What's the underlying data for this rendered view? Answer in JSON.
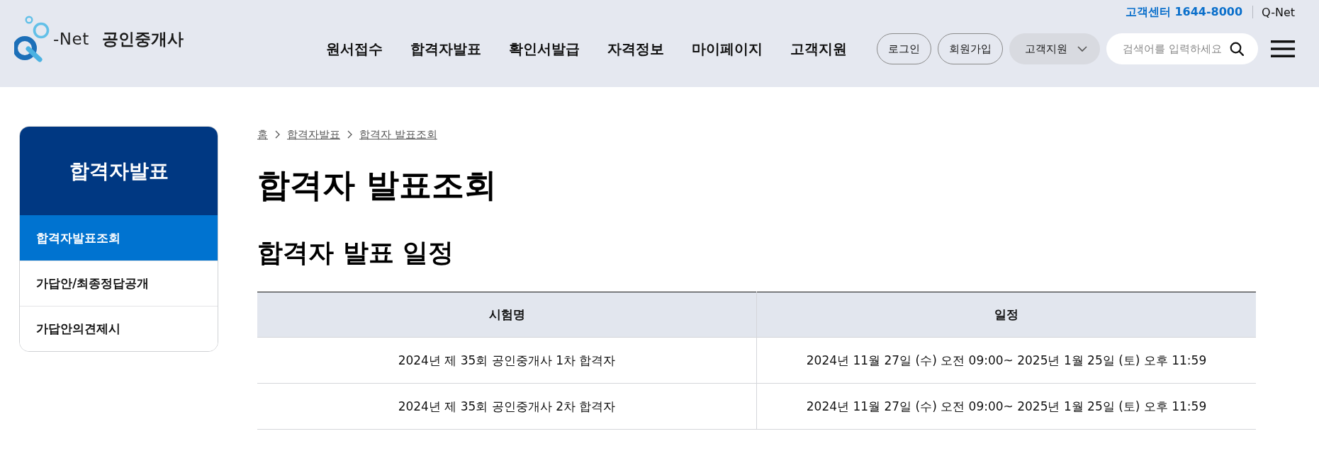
{
  "header": {
    "utility": {
      "phone": "고객센터 1644-8000",
      "link": "Q-Net"
    },
    "logo": {
      "wordmark": "-Net",
      "title": "공인중개사"
    },
    "nav": [
      "원서접수",
      "합격자발표",
      "확인서발급",
      "자격정보",
      "마이페이지",
      "고객지원"
    ],
    "buttons": [
      {
        "label": "로그인",
        "kind": "outline"
      },
      {
        "label": "회원가입",
        "kind": "outline"
      },
      {
        "label": "고객지원",
        "kind": "dropdown"
      }
    ],
    "search": {
      "placeholder": "검색어를 입력하세요"
    }
  },
  "sidebar": {
    "title": "합격자발표",
    "items": [
      {
        "label": "합격자발표조회",
        "selected": true
      },
      {
        "label": "가답안/최종정답공개",
        "selected": false
      },
      {
        "label": "가답안의견제시",
        "selected": false
      }
    ]
  },
  "breadcrumb": [
    "홈",
    "합격자발표",
    "합격자 발표조회"
  ],
  "page_title": "합격자 발표조회",
  "section_title": "합격자 발표 일정",
  "table": {
    "columns": [
      "시험명",
      "일정"
    ],
    "rows": [
      [
        "2024년 제 35회 공인중개사 1차 합격자",
        "2024년 11월 27일 (수) 오전 09:00~ 2025년 1월 25일 (토) 오후 11:59"
      ],
      [
        "2024년 제 35회 공인중개사 2차 합격자",
        "2024년 11월 27일 (수) 오전 09:00~ 2025년 1월 25일 (토) 오후 11:59"
      ]
    ]
  }
}
